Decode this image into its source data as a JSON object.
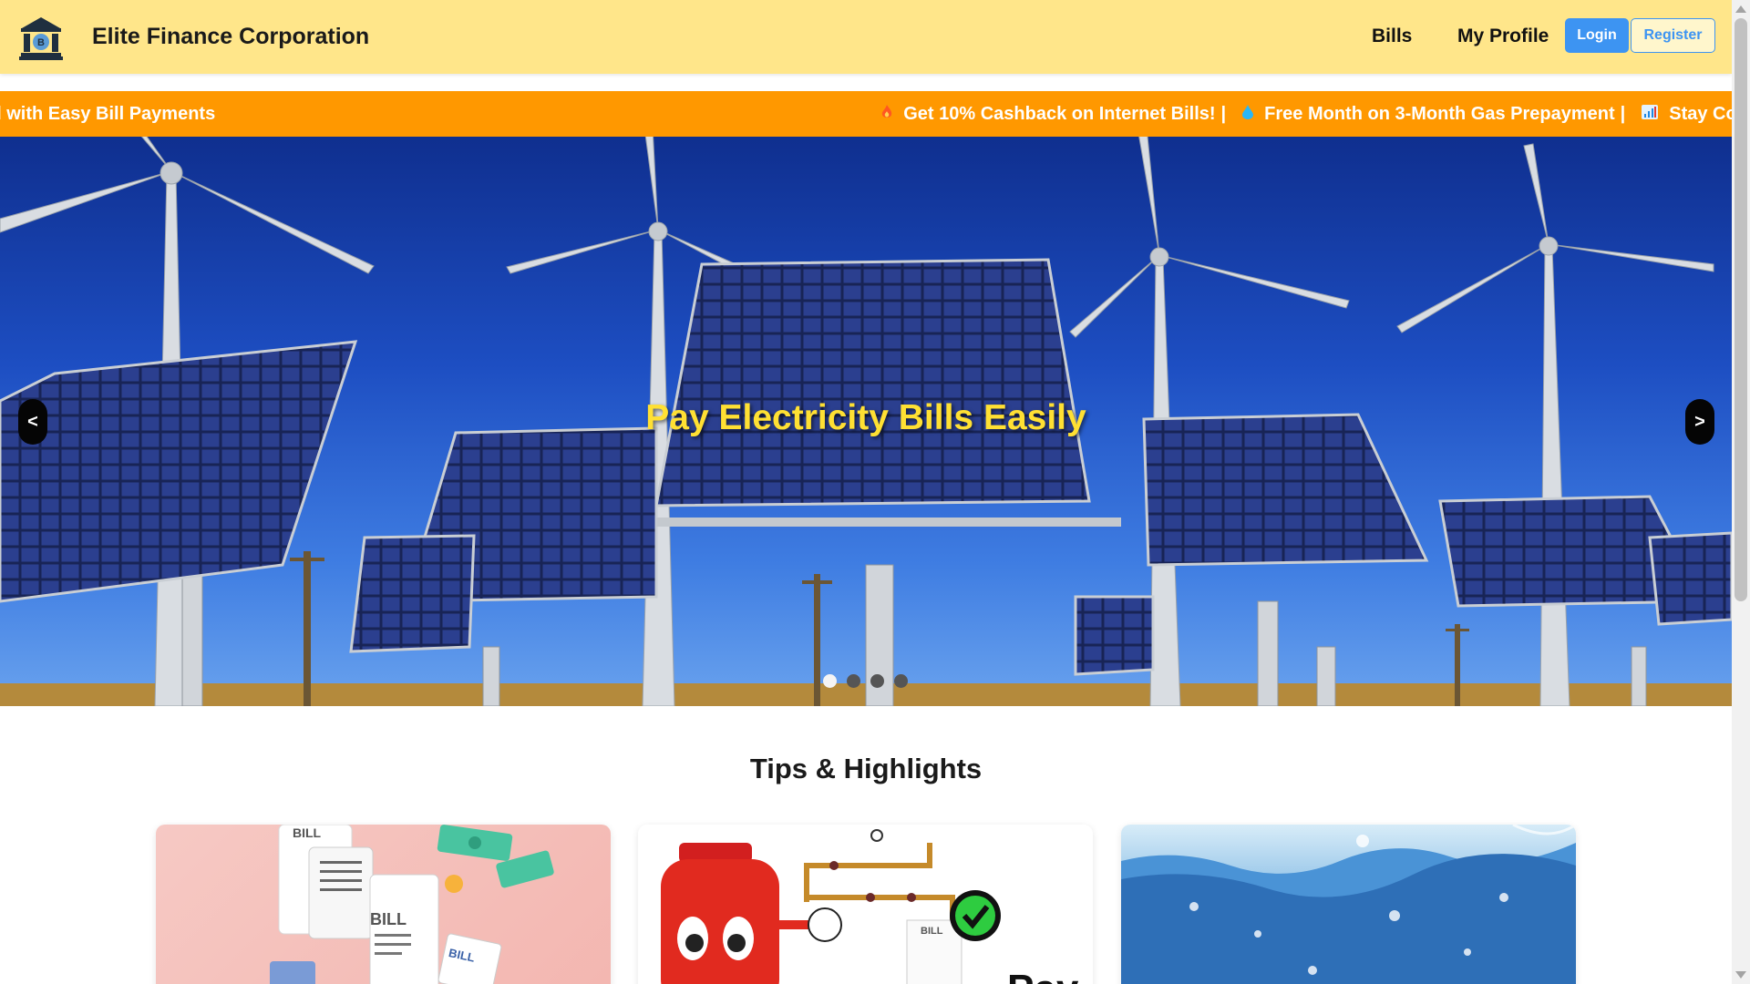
{
  "header": {
    "brand": "Elite Finance Corporation",
    "nav": {
      "bills": "Bills",
      "profile": "My Profile"
    },
    "login_label": "Login",
    "register_label": "Register"
  },
  "ticker": {
    "items": [
      {
        "icon": "plug-icon",
        "text": "nnected with Easy Bill Payments"
      },
      {
        "icon": "fire-icon",
        "text": "Get 10% Cashback on Internet Bills!"
      },
      {
        "icon": "droplet-icon",
        "text": "Free Month on 3-Month Gas Prepayment"
      },
      {
        "icon": "signal-bars-icon",
        "text": "Stay Co"
      }
    ],
    "separator": "|"
  },
  "hero": {
    "title": "Pay Electricity Bills Easily",
    "prev_label": "<",
    "next_label": ">",
    "slide_count": 4,
    "active_slide": 1
  },
  "section": {
    "title": "Tips & Highlights"
  },
  "cards": [
    {
      "image_text": "BILL",
      "image_text_2": "BILL",
      "image_text_3": "BILL"
    },
    {
      "image_text": "BILL",
      "image_text_2": "Pay"
    },
    {}
  ],
  "colors": {
    "header_bg": "#ffe68a",
    "ticker_bg": "#ff9800",
    "accent": "#3d94f2",
    "hero_title": "#ffe033"
  }
}
